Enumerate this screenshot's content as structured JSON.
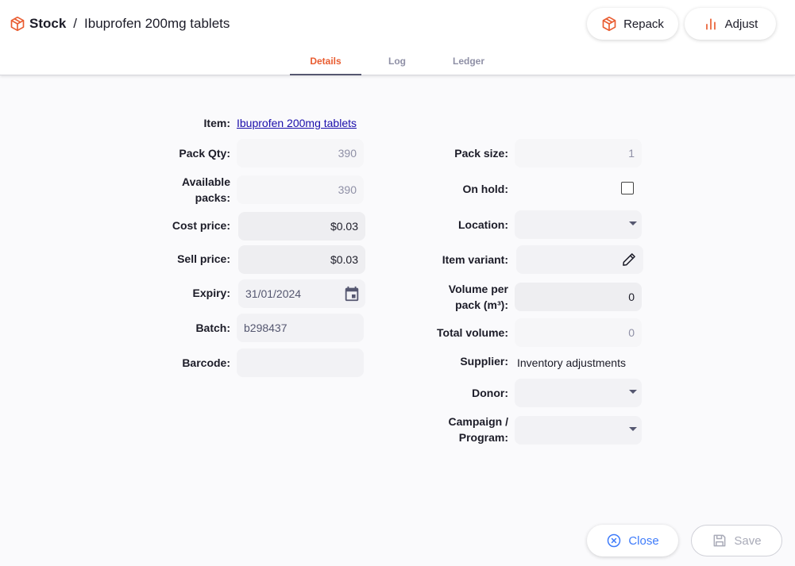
{
  "breadcrumb": {
    "root": "Stock",
    "separator": "/",
    "current": "Ibuprofen 200mg tablets"
  },
  "header": {
    "repack_label": "Repack",
    "adjust_label": "Adjust"
  },
  "tabs": [
    {
      "label": "Details",
      "active": true
    },
    {
      "label": "Log",
      "active": false
    },
    {
      "label": "Ledger",
      "active": false
    }
  ],
  "form_left": {
    "item_label": "Item:",
    "item_value": "Ibuprofen 200mg tablets",
    "pack_qty_label": "Pack Qty:",
    "pack_qty_value": "390",
    "available_packs_label_1": "Available",
    "available_packs_label_2": "packs:",
    "available_packs_value": "390",
    "cost_price_label": "Cost price:",
    "cost_price_value": "$0.03",
    "sell_price_label": "Sell price:",
    "sell_price_value": "$0.03",
    "expiry_label": "Expiry:",
    "expiry_value": "31/01/2024",
    "batch_label": "Batch:",
    "batch_value": "b298437",
    "barcode_label": "Barcode:",
    "barcode_value": ""
  },
  "form_right": {
    "pack_size_label": "Pack size:",
    "pack_size_value": "1",
    "on_hold_label": "On hold:",
    "on_hold_checked": false,
    "location_label": "Location:",
    "location_value": "",
    "item_variant_label": "Item variant:",
    "item_variant_value": "",
    "volume_label_1": "Volume per",
    "volume_label_2": "pack (m³):",
    "volume_value": "0",
    "total_volume_label": "Total volume:",
    "total_volume_value": "0",
    "supplier_label": "Supplier:",
    "supplier_value": "Inventory adjustments",
    "donor_label": "Donor:",
    "donor_value": "",
    "campaign_label_1": "Campaign /",
    "campaign_label_2": "Program:",
    "campaign_value": ""
  },
  "footer": {
    "close_label": "Close",
    "save_label": "Save"
  },
  "colors": {
    "accent": "#e95c30",
    "link": "#1a0dab",
    "primary_blue": "#3e7bfa"
  }
}
